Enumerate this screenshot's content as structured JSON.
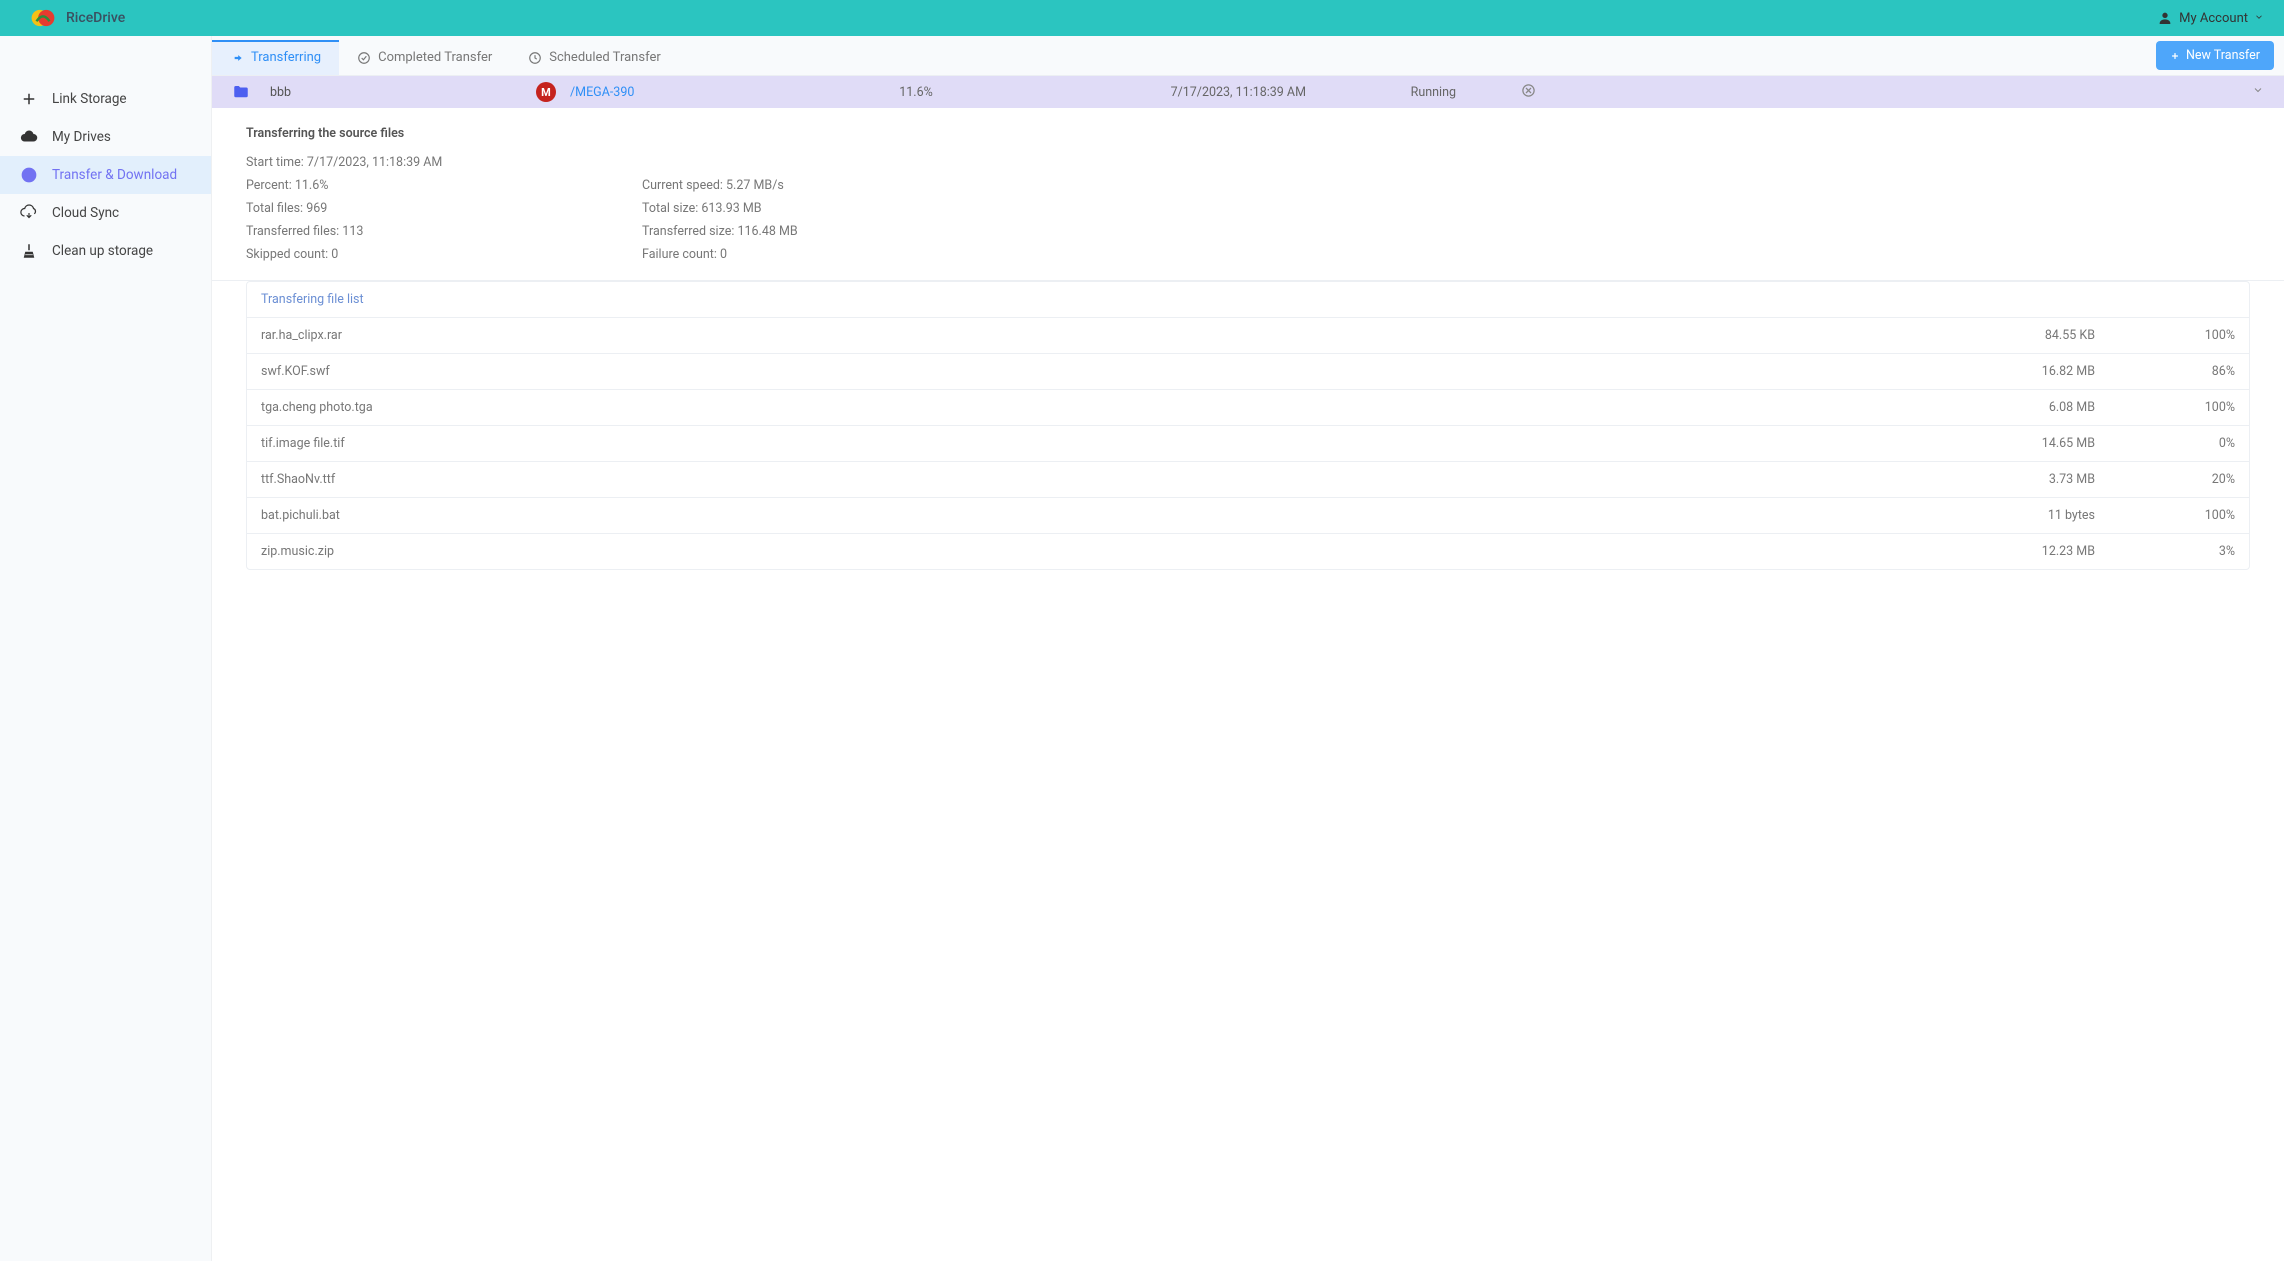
{
  "header": {
    "brand_name": "RiceDrive",
    "account_label": "My Account"
  },
  "sidebar": {
    "items": [
      {
        "label": "Link Storage"
      },
      {
        "label": "My Drives"
      },
      {
        "label": "Transfer & Download"
      },
      {
        "label": "Cloud Sync"
      },
      {
        "label": "Clean up storage"
      }
    ]
  },
  "tabs": {
    "items": [
      {
        "label": "Transferring"
      },
      {
        "label": "Completed Transfer"
      },
      {
        "label": "Scheduled Transfer"
      }
    ],
    "new_transfer_label": "New Transfer"
  },
  "task": {
    "source_name": "bbb",
    "dest_path": "/MEGA-390",
    "percent": "11.6%",
    "time": "7/17/2023, 11:18:39 AM",
    "status": "Running"
  },
  "detail": {
    "title": "Transferring the source files",
    "start_time_label": "Start time: ",
    "start_time_value": "7/17/2023, 11:18:39 AM",
    "percent_label": "Percent: ",
    "percent_value": "11.6%",
    "speed_label": "Current speed: ",
    "speed_value": "5.27 MB/s",
    "total_files_label": "Total files: ",
    "total_files_value": "969",
    "total_size_label": "Total size: ",
    "total_size_value": "613.93 MB",
    "transferred_files_label": "Transferred files: ",
    "transferred_files_value": "113",
    "transferred_size_label": "Transferred size: ",
    "transferred_size_value": "116.48 MB",
    "skipped_label": "Skipped count: ",
    "skipped_value": "0",
    "failure_label": "Failure count: ",
    "failure_value": "0"
  },
  "filelist": {
    "header": "Transfering file list",
    "rows": [
      {
        "name": "rar.ha_clipx.rar",
        "size": "84.55 KB",
        "percent": "100%"
      },
      {
        "name": "swf.KOF.swf",
        "size": "16.82 MB",
        "percent": "86%"
      },
      {
        "name": "tga.cheng photo.tga",
        "size": "6.08 MB",
        "percent": "100%"
      },
      {
        "name": "tif.image file.tif",
        "size": "14.65 MB",
        "percent": "0%"
      },
      {
        "name": "ttf.ShaoNv.ttf",
        "size": "3.73 MB",
        "percent": "20%"
      },
      {
        "name": "bat.pichuli.bat",
        "size": "11 bytes",
        "percent": "100%"
      },
      {
        "name": "zip.music.zip",
        "size": "12.23 MB",
        "percent": "3%"
      }
    ]
  }
}
